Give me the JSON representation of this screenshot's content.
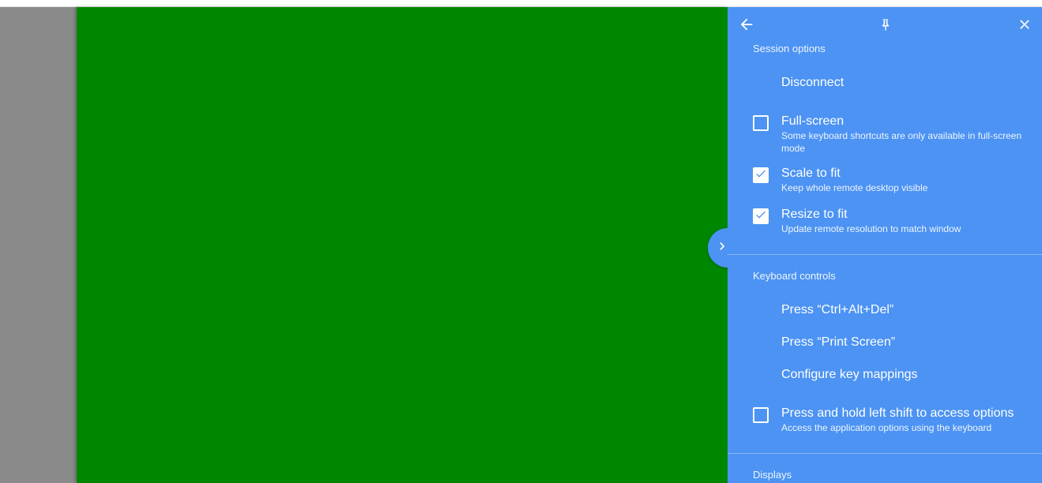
{
  "colors": {
    "panel_bg": "#4c93f3",
    "remote_desktop": "#008700",
    "stage_bg": "#8a8a8a"
  },
  "header": {
    "back_icon": "arrow-back-icon",
    "pin_icon": "pin-icon",
    "close_icon": "close-icon"
  },
  "drawer_toggle_icon": "chevron-right-icon",
  "session": {
    "title": "Session options",
    "disconnect_label": "Disconnect",
    "fullscreen": {
      "label": "Full-screen",
      "desc": "Some keyboard shortcuts are only available in full-screen mode",
      "checked": false
    },
    "scale": {
      "label": "Scale to fit",
      "desc": "Keep whole remote desktop visible",
      "checked": true
    },
    "resize": {
      "label": "Resize to fit",
      "desc": "Update remote resolution to match window",
      "checked": true
    }
  },
  "keyboard": {
    "title": "Keyboard controls",
    "ctrl_alt_del_label": "Press “Ctrl+Alt+Del”",
    "print_screen_label": "Press “Print Screen”",
    "key_mappings_label": "Configure key mappings",
    "shift_hold": {
      "label": "Press and hold left shift to access options",
      "desc": "Access the application options using the keyboard",
      "checked": false
    }
  },
  "displays": {
    "title": "Displays"
  }
}
